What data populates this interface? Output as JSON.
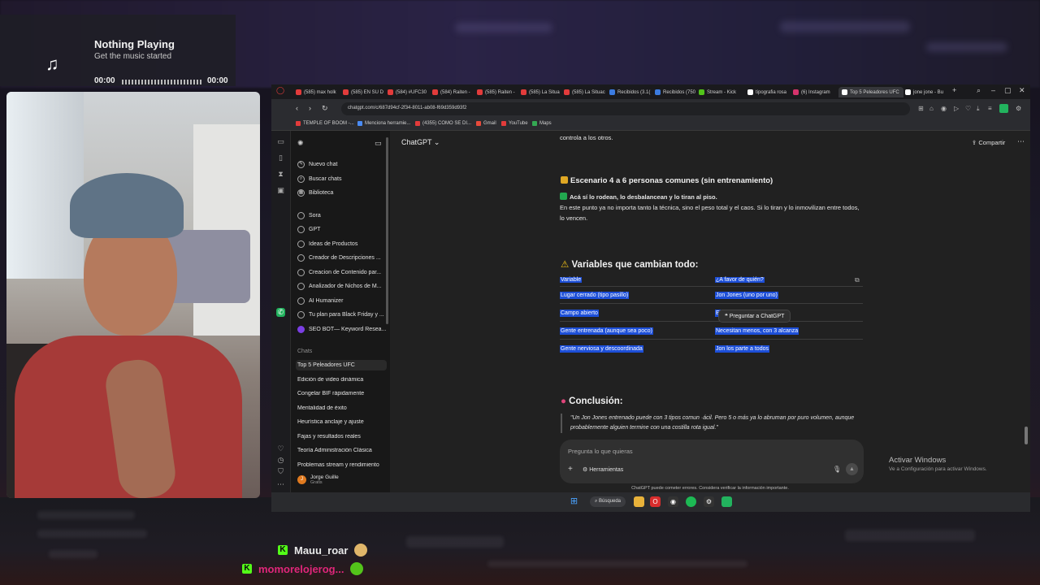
{
  "music": {
    "title": "Nothing Playing",
    "subtitle": "Get the music started",
    "time_current": "00:00",
    "time_total": "00:00",
    "progress": 0
  },
  "browser": {
    "tabs": [
      {
        "label": "(585) max holk"
      },
      {
        "label": "(585) EN SU D"
      },
      {
        "label": "(584) #UFC30"
      },
      {
        "label": "(584) Raiten -"
      },
      {
        "label": "(585) Raiten -"
      },
      {
        "label": "(585) La Situa"
      },
      {
        "label": "(585) La Situac"
      },
      {
        "label": "Recibidos (3.1("
      },
      {
        "label": "Recibidos (750"
      },
      {
        "label": "Stream - Kick"
      },
      {
        "label": "tipografia rosa"
      },
      {
        "label": "(6) Instagram"
      },
      {
        "label": "Top 5 Peleadores UFC"
      },
      {
        "label": "jone jone - Bu"
      }
    ],
    "url": "chatgpt.com/c/687d94cf-2f34-8011-ab08-f69d359d93f2",
    "bookmarks": [
      {
        "label": "TEMPLE OF BOOM -..."
      },
      {
        "label": "Menciona herramie..."
      },
      {
        "label": "(4355) COMO SE DI..."
      },
      {
        "label": "Gmail"
      },
      {
        "label": "YouTube"
      },
      {
        "label": "Maps"
      }
    ]
  },
  "sidebar": {
    "nav": [
      {
        "label": "Nuevo chat",
        "icon": "edit-icon"
      },
      {
        "label": "Buscar chats",
        "icon": "search-icon"
      },
      {
        "label": "Biblioteca",
        "icon": "library-icon"
      }
    ],
    "gpts": [
      {
        "label": "Sora"
      },
      {
        "label": "GPT"
      },
      {
        "label": "Ideas de Productos"
      },
      {
        "label": "Creador de Descripciones ..."
      },
      {
        "label": "Creacion de Contenido par..."
      },
      {
        "label": "Analizador de Nichos de M..."
      },
      {
        "label": "AI Humanizer"
      },
      {
        "label": "Tu plan para Black Friday y ..."
      },
      {
        "label": "SEO BOT— Keyword Resea..."
      }
    ],
    "chats_heading": "Chats",
    "chats": [
      {
        "label": "Top 5 Peleadores UFC"
      },
      {
        "label": "Edición de video dinámica"
      },
      {
        "label": "Congelar BIF rápidamente"
      },
      {
        "label": "Mentalidad de éxito"
      },
      {
        "label": "Heurística anclaje y ajuste"
      },
      {
        "label": "Fajas y resultados reales"
      },
      {
        "label": "Teoría Administración Clásica"
      },
      {
        "label": "Problemas stream y rendimiento"
      }
    ],
    "user_name": "Jorge Guille",
    "user_plan": "Gratis",
    "user_initial": "J"
  },
  "main": {
    "model": "ChatGPT",
    "share": "Compartir",
    "prev_line": "controla a los otros.",
    "scenario_title": "Escenario 4 a 6 personas comunes (sin entrenamiento)",
    "scenario_bold": "Acá sí lo rodean, lo desbalancean y lo tiran al piso.",
    "scenario_body": "En este punto ya no importa tanto la técnica, sino el peso total y el caos. Si lo tiran y lo inmovilizan entre todos, lo vencen.",
    "variables_title": "Variables que cambian todo:",
    "table": {
      "headers": [
        "Variable",
        "¿A favor de quién?"
      ],
      "rows": [
        [
          "Lugar cerrado (tipo pasillo)",
          "Jon Jones (uno por uno)"
        ],
        [
          "Campo abierto",
          "E"
        ],
        [
          "Gente entrenada (aunque sea poco)",
          "Necesitan menos, con 3 alcanza"
        ],
        [
          "Gente nerviosa y descoordinada",
          "Jon los parte a todos"
        ]
      ]
    },
    "ask_popup": "Preguntar a ChatGPT",
    "conclusion_title": "Conclusión:",
    "conclusion_quote": "\"Un Jon Jones entrenado puede con 3 tipos comun  ·ácil. Pero 5 o más ya lo abruman por puro volumen, aunque probablemente alguien termine con una costilla rota igual.\"",
    "composer_placeholder": "Pregunta lo que quieras",
    "tools_label": "Herramientas",
    "disclaimer": "ChatGPT puede cometer errores. Considera verificar la información importante."
  },
  "windows_activation": {
    "line1": "Activar Windows",
    "line2": "Ve a Configuración para activar Windows."
  },
  "taskbar": {
    "search_label": "Búsqueda"
  },
  "stream_chat": [
    {
      "user": "Mauu_roar",
      "color": "#e8e8e8"
    },
    {
      "user": "momorelojerog...",
      "color": "#e0267a"
    }
  ],
  "colors": {
    "selection": "#1d4fd8",
    "kick_green": "#53fc18",
    "chatgpt_bg": "#212121",
    "sidebar_bg": "#181818"
  }
}
